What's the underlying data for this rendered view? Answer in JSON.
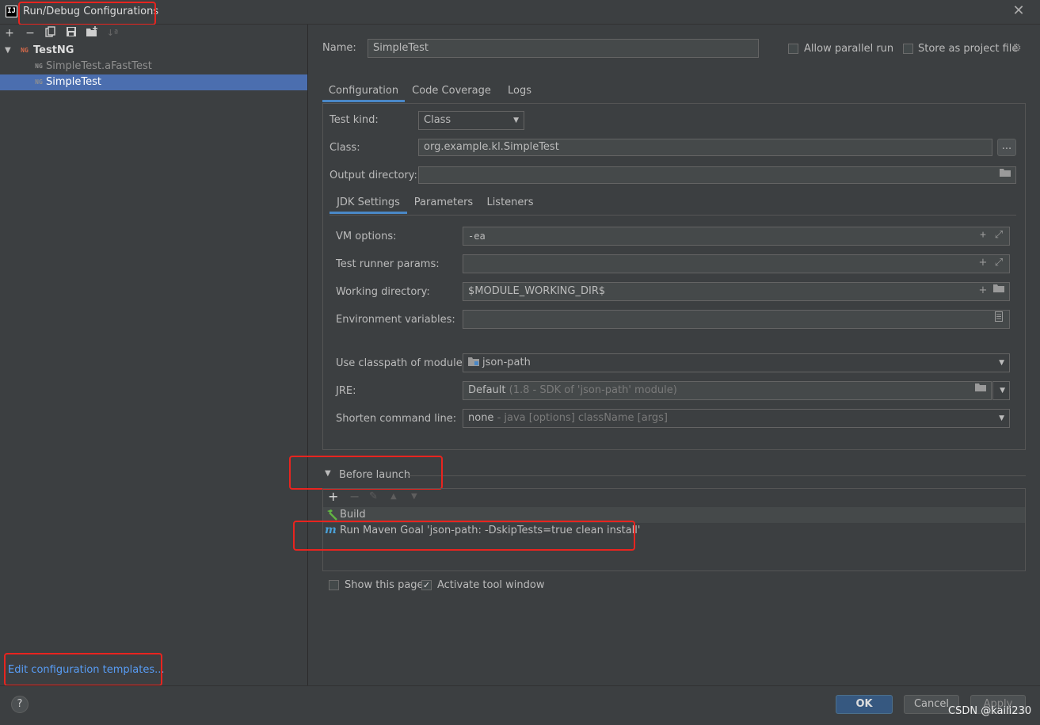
{
  "window": {
    "title": "Run/Debug Configurations",
    "app_icon_text": "IJ",
    "close_glyph": "✕"
  },
  "left": {
    "toolbar": [
      "add-icon",
      "remove-icon",
      "copy-icon",
      "save-icon",
      "new-folder-icon",
      "sort-icon"
    ],
    "tree": {
      "group_label": "TestNG",
      "items": [
        {
          "label": "SimpleTest.aFastTest",
          "selected": false
        },
        {
          "label": "SimpleTest",
          "selected": true
        }
      ]
    },
    "edit_templates_link": "Edit configuration templates..."
  },
  "header": {
    "name_label": "Name:",
    "name_value": "SimpleTest",
    "allow_parallel_label": "Allow parallel run",
    "allow_parallel_checked": false,
    "store_project_label": "Store as project file",
    "store_project_checked": false
  },
  "tabs": [
    {
      "label": "Configuration",
      "active": true
    },
    {
      "label": "Code Coverage",
      "active": false
    },
    {
      "label": "Logs",
      "active": false
    }
  ],
  "config": {
    "test_kind_label": "Test kind:",
    "test_kind_value": "Class",
    "class_label": "Class:",
    "class_value": "org.example.kl.SimpleTest",
    "class_browse": "...",
    "output_dir_label": "Output directory:",
    "output_dir_value": ""
  },
  "subtabs": [
    {
      "label": "JDK Settings",
      "active": true
    },
    {
      "label": "Parameters",
      "active": false
    },
    {
      "label": "Listeners",
      "active": false
    }
  ],
  "jdk": {
    "vm_options_label": "VM options:",
    "vm_options_value": "-ea",
    "runner_params_label": "Test runner params:",
    "runner_params_value": "",
    "working_dir_label": "Working directory:",
    "working_dir_value": "$MODULE_WORKING_DIR$",
    "env_vars_label": "Environment variables:",
    "env_vars_value": "",
    "classpath_label": "Use classpath of module:",
    "classpath_value": "json-path",
    "jre_label": "JRE:",
    "jre_value": "Default",
    "jre_hint": "(1.8 - SDK of 'json-path' module)",
    "shorten_label": "Shorten command line:",
    "shorten_value": "none",
    "shorten_hint": "- java [options] className [args]"
  },
  "before_launch": {
    "title": "Before launch",
    "tasks": [
      {
        "icon": "hammer-icon",
        "label": "Build"
      },
      {
        "icon": "maven-icon",
        "label": "Run Maven Goal 'json-path: -DskipTests=true clean install'"
      }
    ]
  },
  "footer_options": {
    "show_page_label": "Show this page",
    "show_page_checked": false,
    "activate_tool_label": "Activate tool window",
    "activate_tool_checked": true
  },
  "buttons": {
    "help": "?",
    "ok": "OK",
    "cancel": "Cancel",
    "apply": "Apply"
  },
  "watermark": "CSDN @kaili230",
  "colors": {
    "background": "#3c3f41",
    "selection": "#4b6eaf",
    "link": "#589df6",
    "highlight_box": "#e8241f",
    "primary_button": "#365880"
  }
}
